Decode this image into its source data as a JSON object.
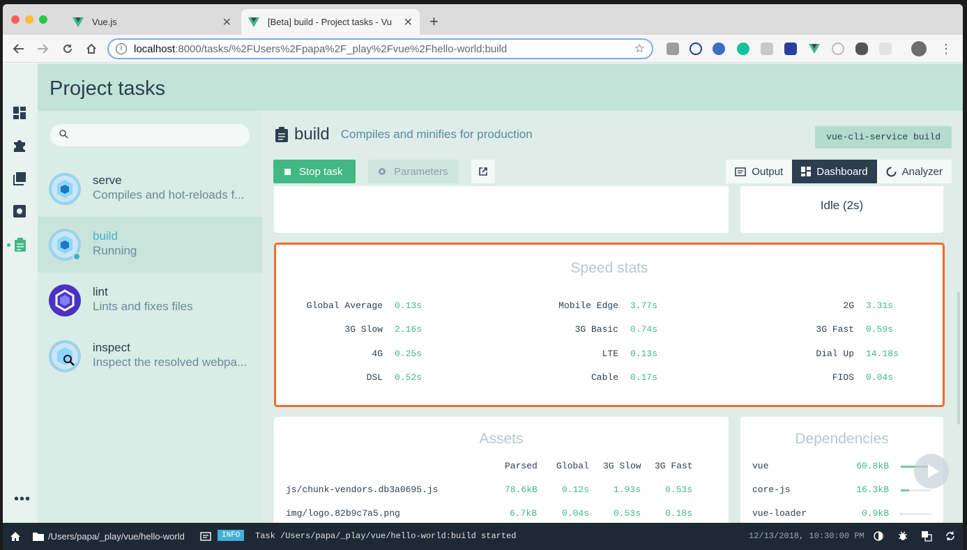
{
  "browser": {
    "tabs": [
      {
        "title": "Vue.js",
        "close": "✕"
      },
      {
        "title": "[Beta] build - Project tasks - Vu",
        "close": "✕"
      }
    ],
    "new_tab": "+",
    "url_host": "localhost",
    "url_path": ":8000/tasks/%2FUsers%2Fpapa%2F_play%2Fvue%2Fhello-world:build"
  },
  "header": {
    "title": "Project tasks"
  },
  "search": {
    "placeholder": ""
  },
  "tasks": [
    {
      "name": "serve",
      "description": "Compiles and hot-reloads f..."
    },
    {
      "name": "build",
      "description": "Running"
    },
    {
      "name": "lint",
      "description": "Lints and fixes files"
    },
    {
      "name": "inspect",
      "description": "Inspect the resolved webpa..."
    }
  ],
  "task_header": {
    "name": "build",
    "description": "Compiles and minifies for production",
    "command": "vue-cli-service build"
  },
  "actions": {
    "stop": "Stop task",
    "parameters": "Parameters"
  },
  "views": {
    "output": "Output",
    "dashboard": "Dashboard",
    "analyzer": "Analyzer"
  },
  "status_card": {
    "text": "Idle (2s)"
  },
  "speed_stats": {
    "title": "Speed stats",
    "rows": [
      [
        {
          "label": "Global Average",
          "value": "0.13s"
        },
        {
          "label": "Mobile Edge",
          "value": "3.77s"
        },
        {
          "label": "2G",
          "value": "3.31s"
        }
      ],
      [
        {
          "label": "3G Slow",
          "value": "2.16s"
        },
        {
          "label": "3G Basic",
          "value": "0.74s"
        },
        {
          "label": "3G Fast",
          "value": "0.59s"
        }
      ],
      [
        {
          "label": "4G",
          "value": "0.25s"
        },
        {
          "label": "LTE",
          "value": "0.13s"
        },
        {
          "label": "Dial Up",
          "value": "14.18s"
        }
      ],
      [
        {
          "label": "DSL",
          "value": "0.52s"
        },
        {
          "label": "Cable",
          "value": "0.17s"
        },
        {
          "label": "FIOS",
          "value": "0.04s"
        }
      ]
    ]
  },
  "assets": {
    "title": "Assets",
    "columns": [
      "Parsed",
      "Global",
      "3G Slow",
      "3G Fast"
    ],
    "rows": [
      {
        "name": "js/chunk-vendors.db3a0695.js",
        "parsed": "78.6kB",
        "global": "0.12s",
        "slow": "1.93s",
        "fast": "0.53s"
      },
      {
        "name": "img/logo.82b9c7a5.png",
        "parsed": "6.7kB",
        "global": "0.04s",
        "slow": "0.53s",
        "fast": "0.18s"
      }
    ]
  },
  "dependencies": {
    "title": "Dependencies",
    "items": [
      {
        "name": "vue",
        "size": "60.8kB",
        "fraction": 1.0
      },
      {
        "name": "core-js",
        "size": "16.3kB",
        "fraction": 0.27
      },
      {
        "name": "vue-loader",
        "size": "0.9kB",
        "fraction": 0.02
      }
    ]
  },
  "statusbar": {
    "path": "/Users/papa/_play/vue/hello-world",
    "badge": "INFO",
    "message": "Task /Users/papa/_play/vue/hello-world:build started",
    "datetime": "12/13/2018, 10:30:00 PM"
  },
  "colors": {
    "accent": "#42b883",
    "highlight_border": "#f26b2a",
    "navy": "#2c3e50"
  }
}
